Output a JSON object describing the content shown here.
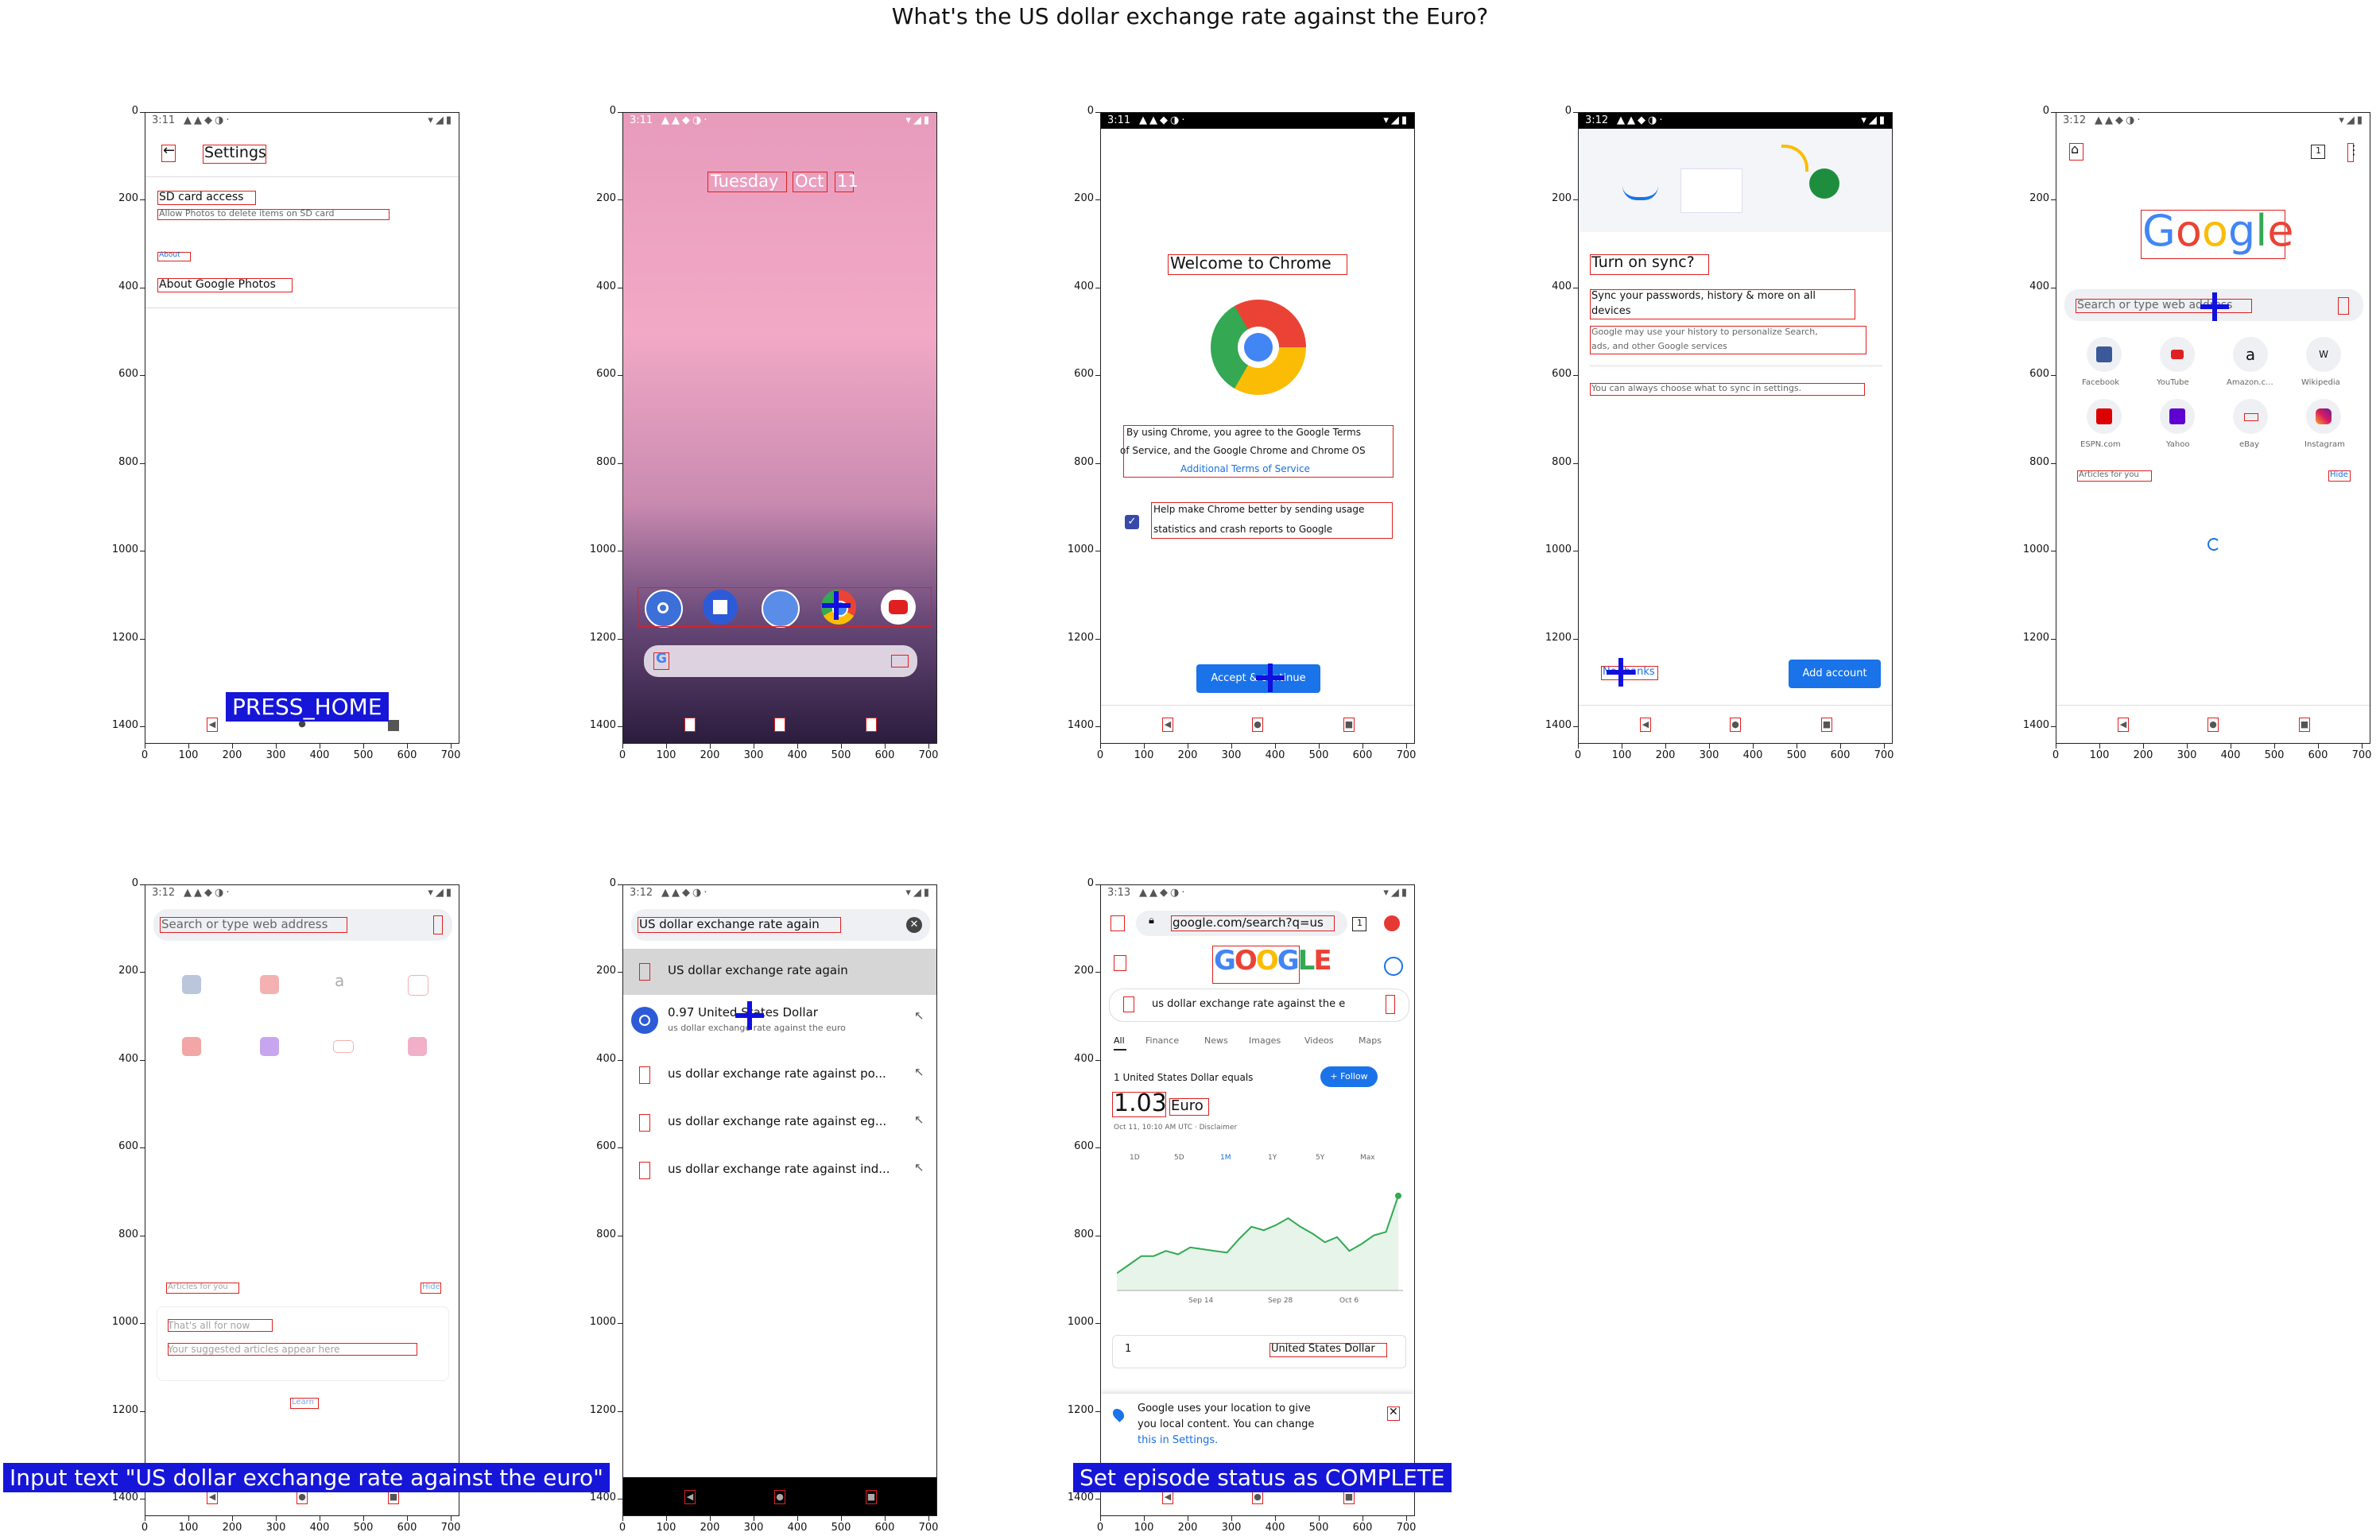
{
  "figure": {
    "title": "What's the US dollar exchange rate against the Euro?"
  },
  "axes": {
    "y_ticks": [
      "0",
      "200",
      "400",
      "600",
      "800",
      "1000",
      "1200",
      "1400"
    ],
    "x_ticks": [
      "0",
      "100",
      "200",
      "300",
      "400",
      "500",
      "600",
      "700"
    ]
  },
  "panels": {
    "p1": {
      "time": "3:11",
      "title": "Settings",
      "items": [
        "SD card access",
        "Allow Photos to delete items on SD card",
        "About",
        "About Google Photos"
      ],
      "action": "PRESS_HOME"
    },
    "p2": {
      "time": "3:11",
      "date": [
        "Tuesday",
        "Oct",
        "11"
      ]
    },
    "p3": {
      "time": "3:11",
      "title": "Welcome to Chrome",
      "terms": [
        "By using Chrome, you agree to the Google Terms",
        "of Service, and the Google Chrome and Chrome OS",
        "Additional Terms of Service"
      ],
      "checkbox_label": [
        "Help make Chrome better by sending usage",
        "statistics and crash reports to Google"
      ],
      "button": "Accept & continue"
    },
    "p4": {
      "time": "3:12",
      "title": "Turn on sync?",
      "desc": [
        "Sync your passwords, history & more on all",
        "devices"
      ],
      "desc2": [
        "Google may use your history to personalize Search,",
        "ads, and other Google services"
      ],
      "note": "You can always choose what to sync in settings.",
      "no_thanks": "No thanks",
      "add_account": "Add account"
    },
    "p5": {
      "time": "3:12",
      "logo": "Google",
      "search_placeholder": "Search or type web address",
      "tab_count": "1",
      "shortcuts": [
        "Facebook",
        "YouTube",
        "Amazon.c...",
        "Wikipedia",
        "ESPN.com",
        "Yahoo",
        "eBay",
        "Instagram"
      ],
      "articles": "Articles for you",
      "hide": "Hide"
    },
    "p6": {
      "time": "3:12",
      "search_placeholder": "Search or type web address",
      "articles": "Articles for you",
      "hide": "Hide",
      "empty": [
        "That's all for now",
        "Your suggested articles appear here"
      ],
      "learn": "Learn",
      "action": "Input text \"US dollar exchange rate against the euro\""
    },
    "p7": {
      "time": "3:12",
      "query": "US dollar exchange rate again",
      "suggestions": [
        "US dollar exchange rate again",
        "0.97 United States Dollar",
        "us dollar exchange rate against the euro",
        "us dollar exchange rate against po...",
        "us dollar exchange rate against eg...",
        "us dollar exchange rate against ind..."
      ]
    },
    "p8": {
      "time": "3:13",
      "url": "google.com/search?q=us",
      "tab_count": "1",
      "search_text": "us dollar exchange rate against the e",
      "tabs": [
        "All",
        "Finance",
        "News",
        "Images",
        "Videos",
        "Maps"
      ],
      "follow": "+ Follow",
      "subhead": "1 United States Dollar equals",
      "rate": "1.03",
      "currency": "Euro",
      "timestamp": "Oct 11, 10:10 AM UTC · Disclaimer",
      "ranges": [
        "1D",
        "5D",
        "1M",
        "1Y",
        "5Y",
        "Max"
      ],
      "chart_labels_x": [
        "Sep 14",
        "Sep 28",
        "Oct 6"
      ],
      "converter_from": "1",
      "converter_to": "United States Dollar",
      "location_msg": [
        "Google uses your location to give",
        "you local content. You can change",
        "this in Settings."
      ],
      "action": "Set episode status as COMPLETE"
    }
  },
  "chart_data": {
    "type": "line",
    "title": "",
    "x": [
      0,
      1,
      2,
      3,
      4,
      5,
      6,
      7,
      8,
      9,
      10,
      11,
      12,
      13,
      14,
      15,
      16,
      17,
      18,
      19,
      20,
      21,
      22,
      23
    ],
    "values": [
      0.985,
      0.99,
      0.995,
      0.995,
      0.998,
      0.996,
      1.0,
      0.999,
      0.998,
      0.997,
      1.005,
      1.012,
      1.01,
      1.013,
      1.017,
      1.012,
      1.008,
      1.003,
      1.006,
      0.998,
      1.002,
      1.007,
      1.009,
      1.03
    ],
    "xlabel": "",
    "ylabel": "",
    "colors": {
      "line": "#34a853",
      "fill": "#e6f4ea"
    }
  }
}
